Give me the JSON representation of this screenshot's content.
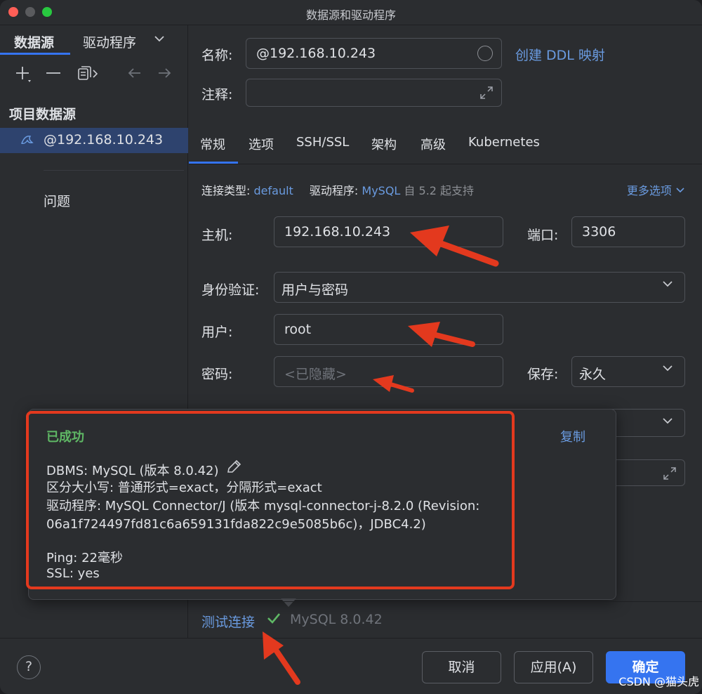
{
  "window": {
    "title": "数据源和驱动程序"
  },
  "sidebar": {
    "tabs": [
      {
        "label": "数据源"
      },
      {
        "label": "驱动程序"
      }
    ],
    "section_title": "项目数据源",
    "items": [
      {
        "label": "@192.168.10.243"
      }
    ],
    "problems_label": "问题"
  },
  "header": {
    "name_label": "名称:",
    "name_value": "@192.168.10.243",
    "ddl_link": "创建 DDL 映射",
    "comment_label": "注释:",
    "comment_value": ""
  },
  "tabs": [
    {
      "label": "常规"
    },
    {
      "label": "选项"
    },
    {
      "label": "SSH/SSL"
    },
    {
      "label": "架构"
    },
    {
      "label": "高级"
    },
    {
      "label": "Kubernetes"
    }
  ],
  "connection": {
    "type_label": "连接类型:",
    "type_value": "default",
    "driver_label": "驱动程序:",
    "driver_value": "MySQL",
    "driver_note": "自 5.2 起支持",
    "more_options": "更多选项"
  },
  "form": {
    "host_label": "主机:",
    "host_value": "192.168.10.243",
    "port_label": "端口:",
    "port_value": "3306",
    "auth_label": "身份验证:",
    "auth_value": "用户与密码",
    "user_label": "用户:",
    "user_value": "root",
    "password_label": "密码:",
    "password_placeholder": "<已隐藏>",
    "save_label": "保存:",
    "save_value": "永久"
  },
  "popup": {
    "status": "已成功",
    "copy_label": "复制",
    "lines": [
      "DBMS: MySQL (版本 8.0.42)",
      "区分大小写: 普通形式=exact，分隔形式=exact",
      "驱动程序: MySQL Connector/J (版本 mysql-connector-j-8.2.0 (Revision:",
      "06a1f724497fd81c6a659131fda822c9e5085b6c)，JDBC4.2)",
      "Ping: 22毫秒",
      "SSL: yes"
    ]
  },
  "test": {
    "link_label": "测试连接",
    "version": "MySQL 8.0.42"
  },
  "footer": {
    "help": "?",
    "cancel": "取消",
    "apply": "应用(A)",
    "ok": "确定",
    "watermark": "CSDN @猫头虎"
  },
  "colors": {
    "accent": "#3574f0",
    "link": "#6a9be0",
    "success": "#5fb865",
    "annotation_red": "#e3391e",
    "background": "#2b2d30"
  }
}
